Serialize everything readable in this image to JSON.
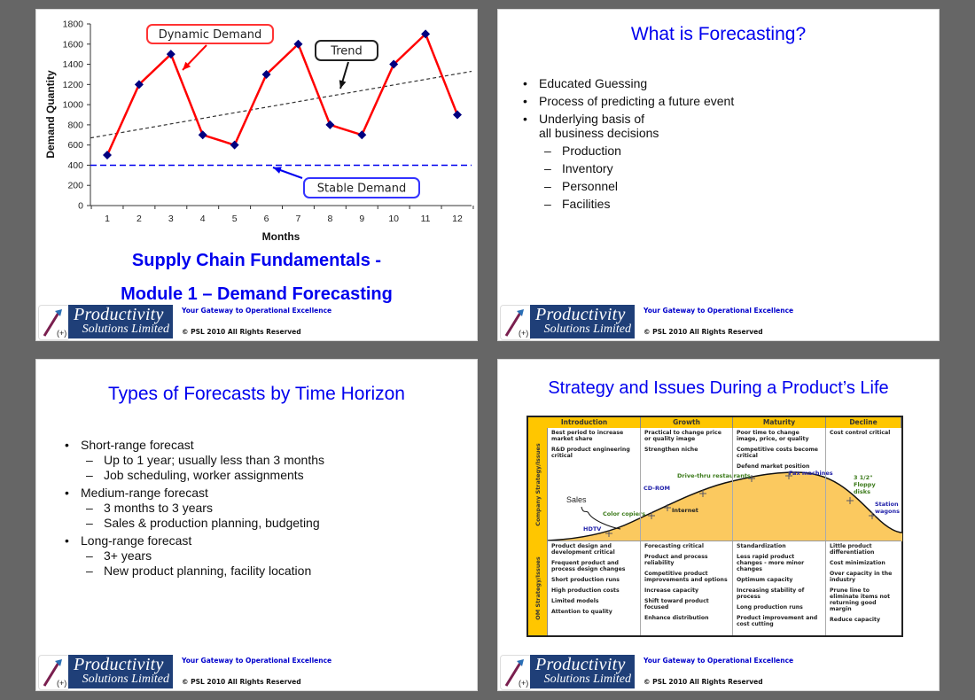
{
  "theme": {
    "title_color": "#0000ee",
    "tagline_color": "#0000cc",
    "background": "#666666",
    "yellow": "#ffc600",
    "curve_fill": "#fbc95f"
  },
  "footer": {
    "logo_line1": "Productivity",
    "logo_line2": "Solutions Limited",
    "logo_plus": "(+)",
    "tagline": "Your Gateway to Operational Excellence",
    "copyright": "© PSL 2010 All Rights Reserved"
  },
  "slide1": {
    "title_line1": "Supply Chain Fundamentals -",
    "title_line2": "Module 1 – Demand Forecasting"
  },
  "chart_data": {
    "type": "line",
    "title": "",
    "xlabel": "Months",
    "ylabel": "Demand Quantity",
    "x": [
      1,
      2,
      3,
      4,
      5,
      6,
      7,
      8,
      9,
      10,
      11,
      12
    ],
    "ylim": [
      0,
      1800
    ],
    "yticks": [
      0,
      200,
      400,
      600,
      800,
      1000,
      1200,
      1400,
      1600,
      1800
    ],
    "grid": false,
    "series": [
      {
        "name": "Dynamic Demand",
        "values": [
          500,
          1200,
          1500,
          700,
          600,
          1300,
          1600,
          800,
          700,
          1400,
          1700,
          900
        ],
        "color": "#ff0000",
        "marker": "diamond",
        "marker_color": "#000080"
      },
      {
        "name": "Trend",
        "start_value": 670,
        "end_value": 1330,
        "color": "#333333",
        "style": "dashed"
      },
      {
        "name": "Stable Demand",
        "value": 400,
        "color": "#0000ee",
        "style": "dashed"
      }
    ],
    "annotations": [
      {
        "text": "Dynamic Demand",
        "border": "#ff3333",
        "arrow_color": "#ff0000"
      },
      {
        "text": "Trend",
        "border": "#222222",
        "arrow_color": "#111111"
      },
      {
        "text": "Stable Demand",
        "border": "#3333ff",
        "arrow_color": "#0000ee"
      }
    ]
  },
  "slide2": {
    "title": "What is Forecasting?",
    "bullets": [
      {
        "level": 1,
        "text": "Educated Guessing"
      },
      {
        "level": 1,
        "text": "Process of predicting a future event"
      },
      {
        "level": 1,
        "text": "Underlying basis of"
      },
      {
        "level": 0,
        "text": "all business decisions"
      },
      {
        "level": 2,
        "text": "Production"
      },
      {
        "level": 2,
        "text": "Inventory"
      },
      {
        "level": 2,
        "text": "Personnel"
      },
      {
        "level": 2,
        "text": "Facilities"
      }
    ]
  },
  "slide3": {
    "title": "Types of Forecasts by Time Horizon",
    "bullets": [
      {
        "level": 1,
        "text": "Short-range forecast"
      },
      {
        "level": 2,
        "text": "Up to 1 year; usually less than 3 months"
      },
      {
        "level": 2,
        "text": "Job scheduling, worker assignments"
      },
      {
        "level": 1,
        "text": "Medium-range forecast"
      },
      {
        "level": 2,
        "text": "3 months to 3 years"
      },
      {
        "level": 2,
        "text": "Sales & production planning, budgeting"
      },
      {
        "level": 1,
        "text": "Long-range forecast"
      },
      {
        "level": 2,
        "text": "3+ years"
      },
      {
        "level": 2,
        "text": "New product planning, facility location"
      }
    ]
  },
  "slide4": {
    "title": "Strategy and Issues During a Product’s Life",
    "side_labels": [
      "Company Strategy/Issues",
      "OM Strategy/Issues"
    ],
    "phases": [
      "Introduction",
      "Growth",
      "Maturity",
      "Decline"
    ],
    "company": [
      [
        "Best period to increase market share",
        "R&D product engineering critical"
      ],
      [
        "Practical to change price or quality image",
        "Strengthen niche"
      ],
      [
        "Poor time to change image, price, or quality",
        "Competitive costs become critical",
        "Defend market position"
      ],
      [
        "Cost control critical"
      ]
    ],
    "om": [
      [
        "Product design and development critical",
        "Frequent product and process design changes",
        "Short production runs",
        "High production costs",
        "Limited models",
        "Attention to quality"
      ],
      [
        "Forecasting critical",
        "Product and process reliability",
        "Competitive product improvements and options",
        "Increase capacity",
        "Shift toward product focused",
        "Enhance distribution"
      ],
      [
        "Standardization",
        "Less rapid product changes - more minor changes",
        "Optimum  capacity",
        "Increasing stability of process",
        "Long production runs",
        "Product improvement and cost cutting"
      ],
      [
        "Little product differentiation",
        "Cost minimization",
        "Over capacity in the industry",
        "Prune line to eliminate items not returning good margin",
        "Reduce capacity"
      ]
    ],
    "curve_label": "Sales",
    "products": [
      {
        "name": "HDTV",
        "color": "#2222aa"
      },
      {
        "name": "Color copiers",
        "color": "#3b7a1a"
      },
      {
        "name": "Internet",
        "color": "#222222"
      },
      {
        "name": "CD-ROM",
        "color": "#2222aa"
      },
      {
        "name": "Drive-thru restaurants",
        "color": "#3b7a1a"
      },
      {
        "name": "Fax machines",
        "color": "#2222aa"
      },
      {
        "name": "3 1/2\" Floppy disks",
        "color": "#3b7a1a"
      },
      {
        "name": "Station wagons",
        "color": "#2222aa"
      }
    ]
  }
}
